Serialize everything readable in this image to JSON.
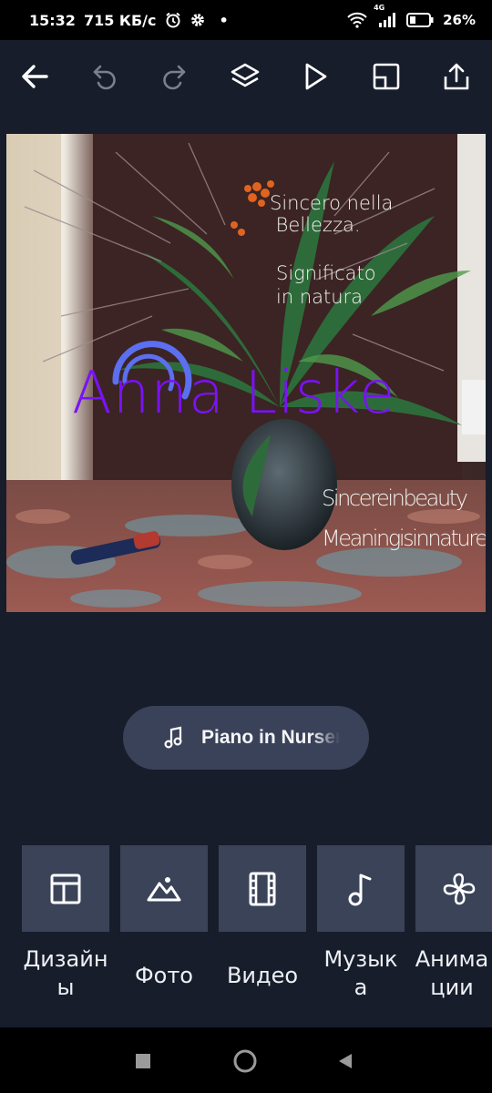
{
  "status_bar": {
    "time": "15:32",
    "speed": "715 КБ/с",
    "dot": "•",
    "network": "4G",
    "battery": "26%",
    "icons": [
      "alarm-icon",
      "gear-icon",
      "wifi-icon",
      "signal-icon",
      "battery-icon"
    ]
  },
  "toolbar": {
    "icons": [
      "back-arrow-icon",
      "undo-icon",
      "redo-icon",
      "layers-icon",
      "play-icon",
      "resize-icon",
      "share-icon"
    ]
  },
  "canvas": {
    "text_it_1": "Sincero nella\n Bellezza.",
    "text_it_2": "Significato\nin natura",
    "text_name": "Anna Liske",
    "text_en_1": "Sincereinbeauty",
    "text_en_2": "Meaningisinnature"
  },
  "audio": {
    "track": "Piano in Nursery"
  },
  "categories": [
    {
      "label": "Дизайн\nы",
      "icon": "layout-icon"
    },
    {
      "label": "Фото",
      "icon": "photo-icon"
    },
    {
      "label": "Видео",
      "icon": "film-icon"
    },
    {
      "label": "Музык\nа",
      "icon": "music-note-icon"
    },
    {
      "label": "Анима\nции",
      "icon": "pinwheel-icon"
    }
  ],
  "colors": {
    "background": "#171d2b",
    "tile": "#3a4358",
    "chip": "#394258",
    "name_text": "#7a12f5"
  }
}
